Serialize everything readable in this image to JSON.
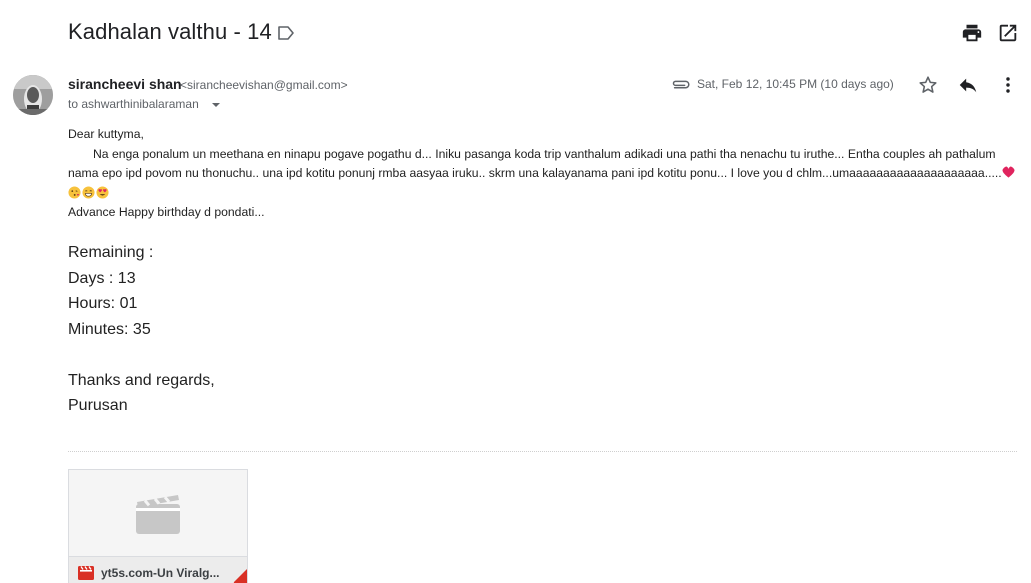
{
  "subject": "Kadhalan valthu - 14",
  "header_icons": {
    "label": "label-arrow-icon",
    "print": "print-icon",
    "open_new": "open-in-new-window-icon"
  },
  "sender": {
    "name": "sirancheevi shan",
    "email": "<sirancheevishan@gmail.com>",
    "to": "to ashwarthinibalaraman",
    "date": "Sat, Feb 12, 10:45 PM (10 days ago)"
  },
  "actions": {
    "star": "star-icon",
    "reply": "reply-icon",
    "more": "more-vertical-icon"
  },
  "message": {
    "greeting": "Dear kuttyma,",
    "paragraph": "Na enga ponalum un meethana en ninapu pogave pogathu d... Iniku pasanga koda trip vanthalum adikadi una pathi tha nenachu tu iruthe... Entha couples ah pathalum nama epo ipd povom nu thonuchu.. una ipd kotitu ponunj rmba aasyaa iruku.. skrm una kalayanama pani ipd kotitu ponu... I love you d chlm...umaaaaaaaaaaaaaaaaaaaa.....",
    "emojis": [
      "heart-emoji",
      "kiss-face-emoji",
      "grin-face-emoji",
      "heart-eyes-emoji"
    ],
    "closing_line": "Advance Happy birthday d pondati...",
    "remaining_title": "Remaining :",
    "days": "Days : 13",
    "hours": "Hours: 01",
    "minutes": "Minutes: 35",
    "thanks": "Thanks and regards,",
    "signature": "Purusan"
  },
  "attachment": {
    "name": "yt5s.com-Un Viralg...",
    "icon": "video-file-icon"
  },
  "colors": {
    "text_dark": "#202124",
    "text_muted": "#5f6368",
    "icon_gray": "#5f6368",
    "video_red": "#d93025",
    "heart_red": "#e0245e",
    "emoji_yellow": "#f7c23c"
  }
}
